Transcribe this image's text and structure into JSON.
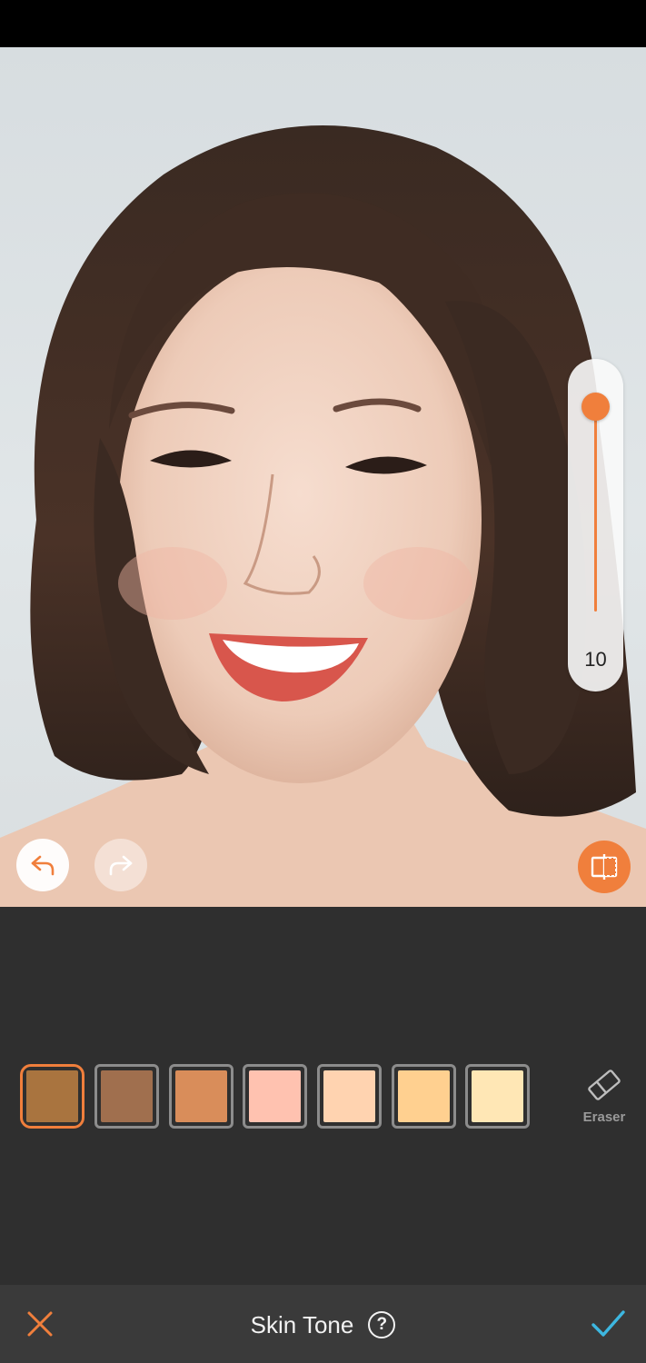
{
  "slider": {
    "value": "10",
    "level": 1.0
  },
  "toolbar": {
    "undo_icon": "undo-icon",
    "redo_icon": "redo-icon",
    "compare_icon": "compare-icon"
  },
  "skin_tone": {
    "swatches": [
      {
        "color": "#a9743f",
        "selected": true
      },
      {
        "color": "#a06f4e",
        "selected": false
      },
      {
        "color": "#d98d5a",
        "selected": false
      },
      {
        "color": "#ffc2b0",
        "selected": false
      },
      {
        "color": "#ffd3b0",
        "selected": false
      },
      {
        "color": "#ffd090",
        "selected": false
      },
      {
        "color": "#ffe7b5",
        "selected": false
      }
    ],
    "eraser_label": "Eraser"
  },
  "bottom_bar": {
    "title": "Skin Tone",
    "help": "?"
  },
  "colors": {
    "accent": "#f07f3c",
    "confirm": "#3db7e0",
    "panel": "#2f2f2f"
  }
}
